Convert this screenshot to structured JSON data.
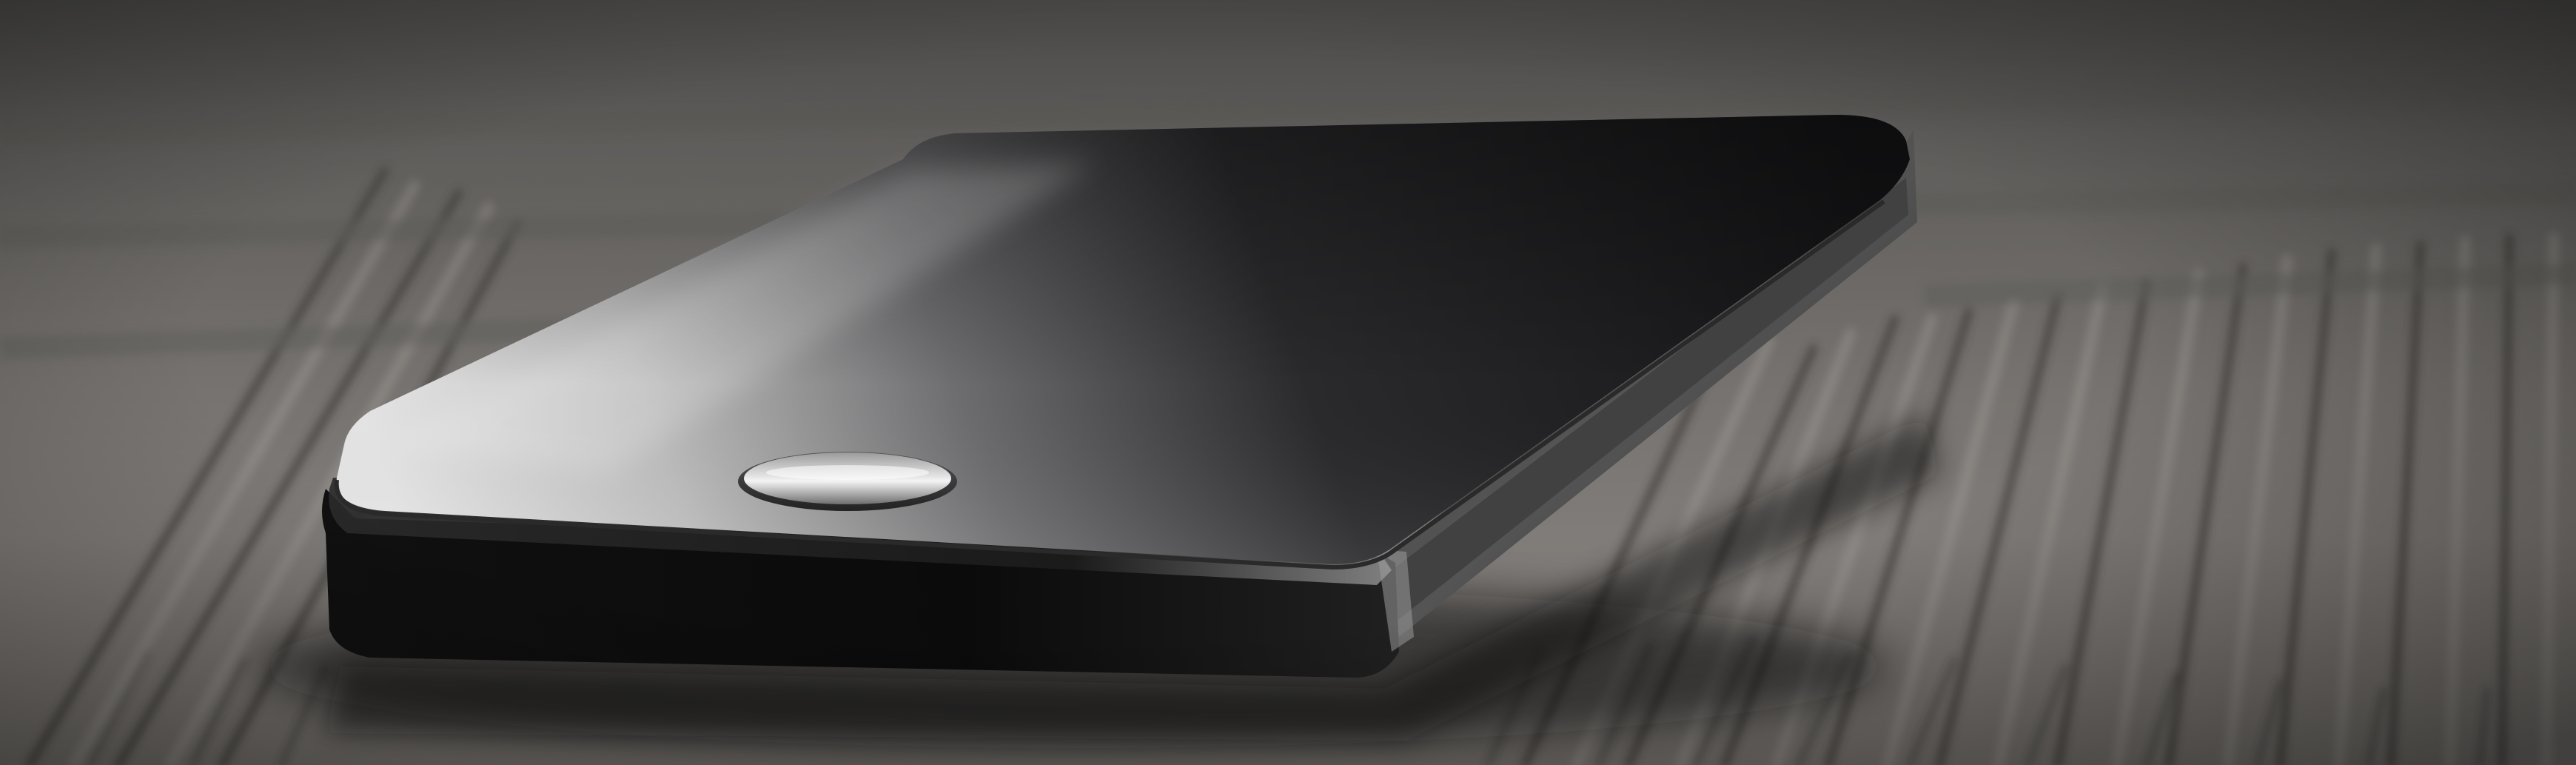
{
  "scene": {
    "subject": "smartphone",
    "surface": "wood",
    "palette": {
      "wood_light": "#8e8b88",
      "wood_mid": "#6b6865",
      "wood_dark": "#3a3836",
      "phone_body": "#151515",
      "screen_reflection": "#d9d9d9",
      "home_button": "#c8c8c8",
      "metal_edge": "#5a5a5a"
    }
  }
}
